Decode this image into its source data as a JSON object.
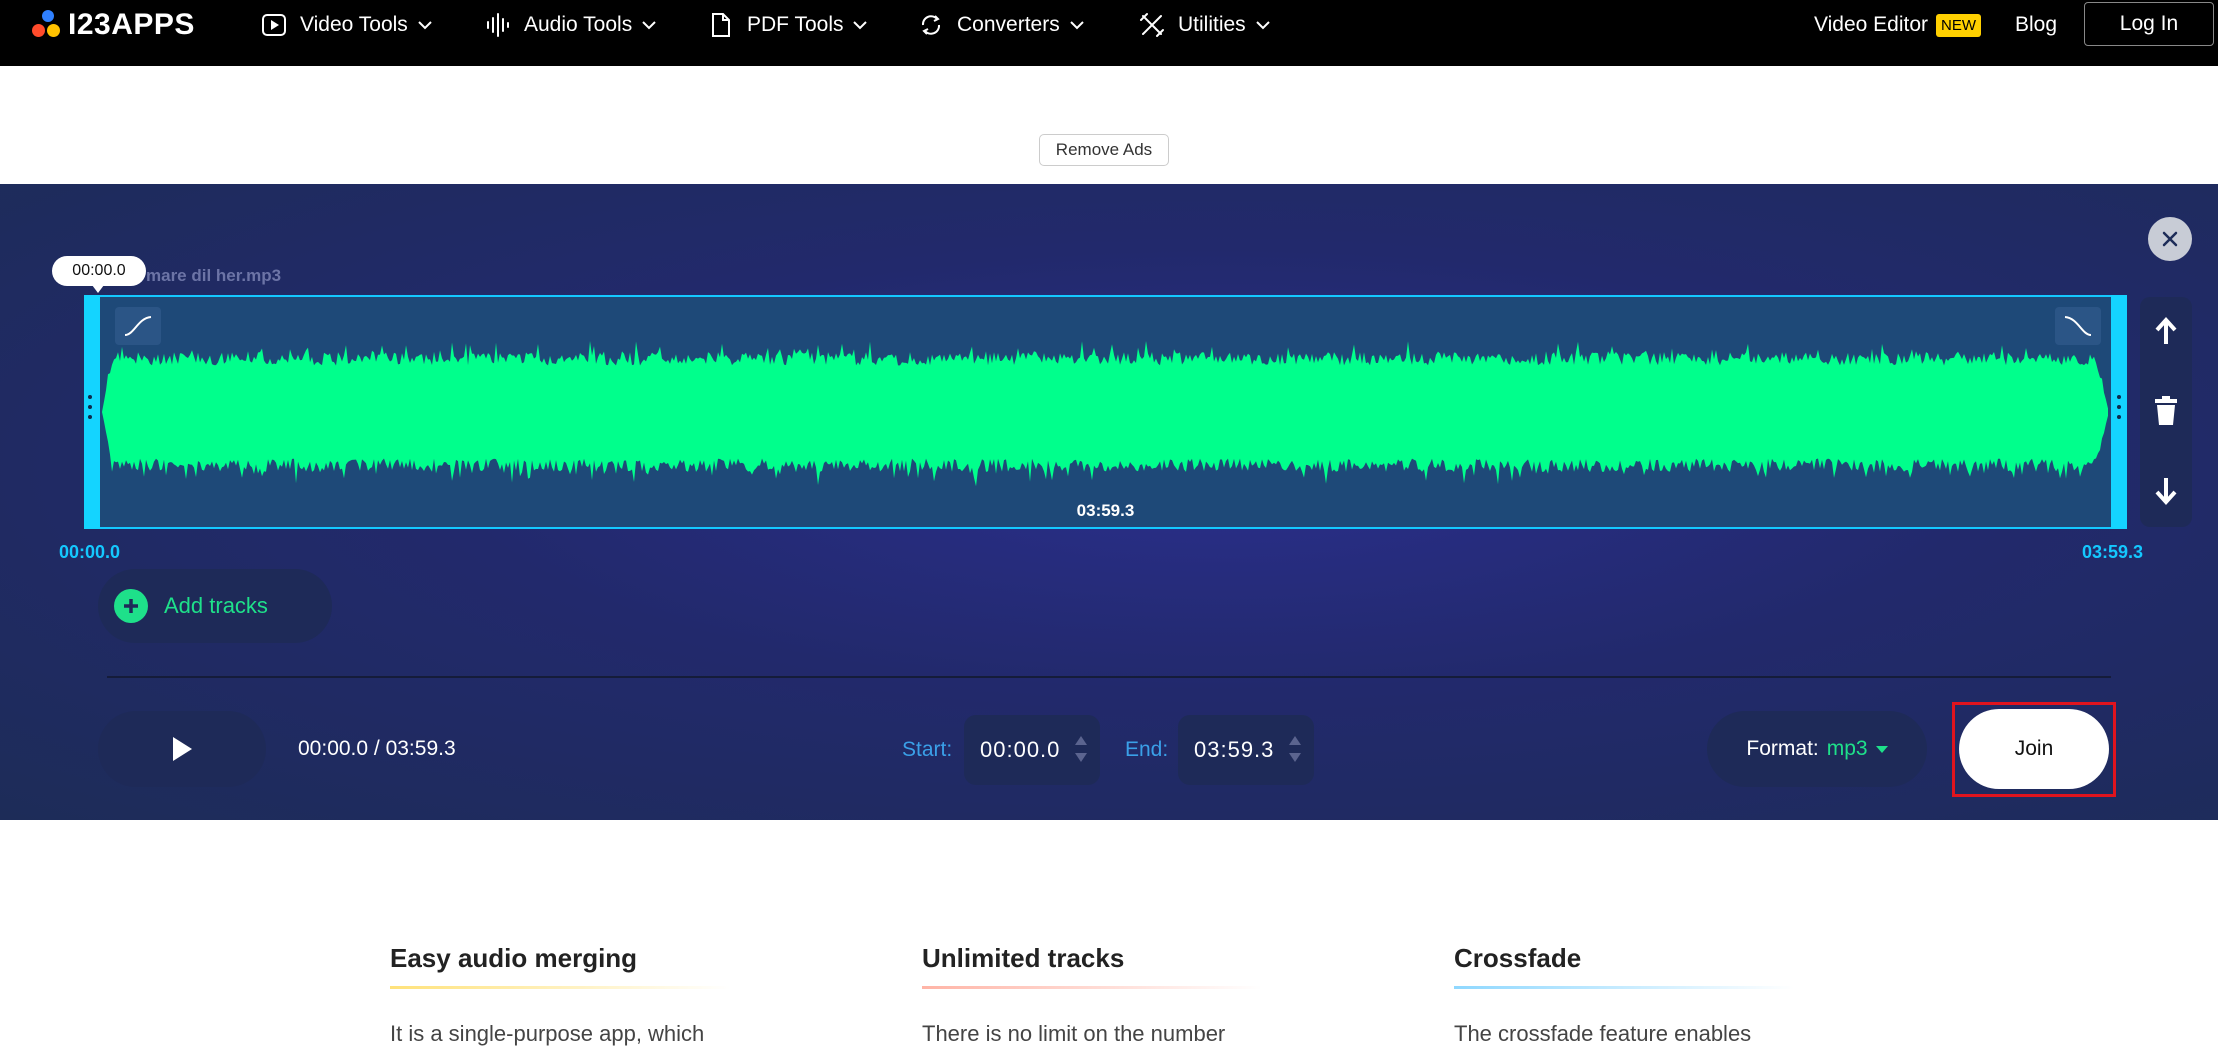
{
  "nav": {
    "logo": "I23APPS",
    "items": [
      {
        "label": "Video Tools",
        "icon": "video-icon"
      },
      {
        "label": "Audio Tools",
        "icon": "audio-wave-icon"
      },
      {
        "label": "PDF Tools",
        "icon": "document-icon"
      },
      {
        "label": "Converters",
        "icon": "convert-icon"
      },
      {
        "label": "Utilities",
        "icon": "tools-icon"
      }
    ],
    "video_editor": "Video Editor",
    "new_badge": "NEW",
    "blog": "Blog",
    "login": "Log In"
  },
  "ads": {
    "remove_ads": "Remove Ads"
  },
  "editor": {
    "playhead_time": "00:00.0",
    "file_name": "mare dil her.mp3",
    "track_duration": "03:59.3",
    "range_start": "00:00.0",
    "range_end": "03:59.3",
    "add_tracks": "Add tracks",
    "current_time": "00:00.0 / 03:59.3",
    "start_label": "Start:",
    "start_value": "00:00.0",
    "end_label": "End:",
    "end_value": "03:59.3",
    "format_label": "Format:",
    "format_value": "mp3",
    "join": "Join"
  },
  "colors": {
    "waveform": "#00ff8c",
    "accent_cyan": "#14c8ff",
    "accent_green": "#1ee08a",
    "highlight_red": "#e0141e"
  },
  "features": [
    {
      "title": "Easy audio merging",
      "text": "It is a single-purpose app, which",
      "underline": "#ffe27a"
    },
    {
      "title": "Unlimited tracks",
      "text": "There is no limit on the number",
      "underline": "#ffb4a6"
    },
    {
      "title": "Crossfade",
      "text": "The crossfade feature enables",
      "underline": "#8fd8ff"
    }
  ]
}
